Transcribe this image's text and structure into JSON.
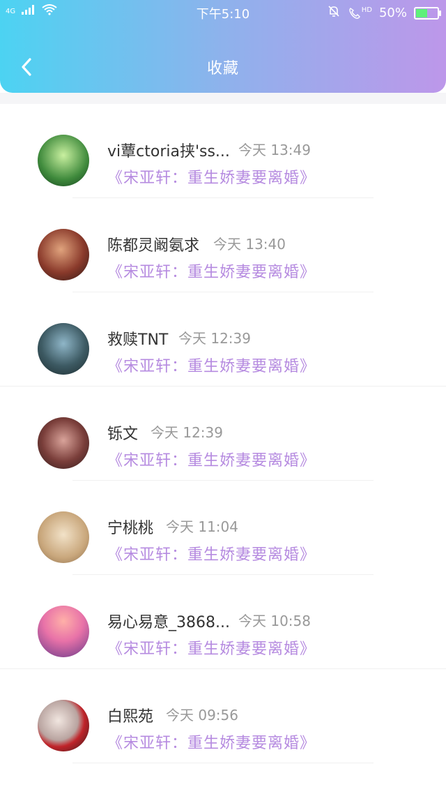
{
  "status_bar": {
    "network": "4G",
    "time": "下午5:10",
    "hd": "HD",
    "battery": "50%",
    "battery_level": 0.5
  },
  "header": {
    "title": "收藏"
  },
  "items": [
    {
      "name": "vi蕈ctoria挟'ss...",
      "time": "今天 13:49",
      "book": "《宋亚轩：重生娇妻要离婚》",
      "avatar": "avatar-green-character"
    },
    {
      "name": "陈都灵阚氨求",
      "time": "今天 13:40",
      "book": "《宋亚轩：重生娇妻要离婚》",
      "avatar": "avatar-man-portrait"
    },
    {
      "name": "救赎TNT",
      "time": "今天 12:39",
      "book": "《宋亚轩：重生娇妻要离婚》",
      "avatar": "avatar-boy-photo"
    },
    {
      "name": "铄文",
      "time": "今天 12:39",
      "book": "《宋亚轩：重生娇妻要离婚》",
      "avatar": "avatar-woman-portrait"
    },
    {
      "name": "宁桃桃",
      "time": "今天 11:04",
      "book": "《宋亚轩：重生娇妻要离婚》",
      "avatar": "avatar-sketch-portrait"
    },
    {
      "name": "易心易意_3868...",
      "time": "今天 10:58",
      "book": "《宋亚轩：重生娇妻要离婚》",
      "avatar": "avatar-sunset-girl"
    },
    {
      "name": "白熙苑",
      "time": "今天 09:56",
      "book": "《宋亚轩：重生娇妻要离婚》",
      "avatar": "avatar-girl-red-flower"
    }
  ]
}
